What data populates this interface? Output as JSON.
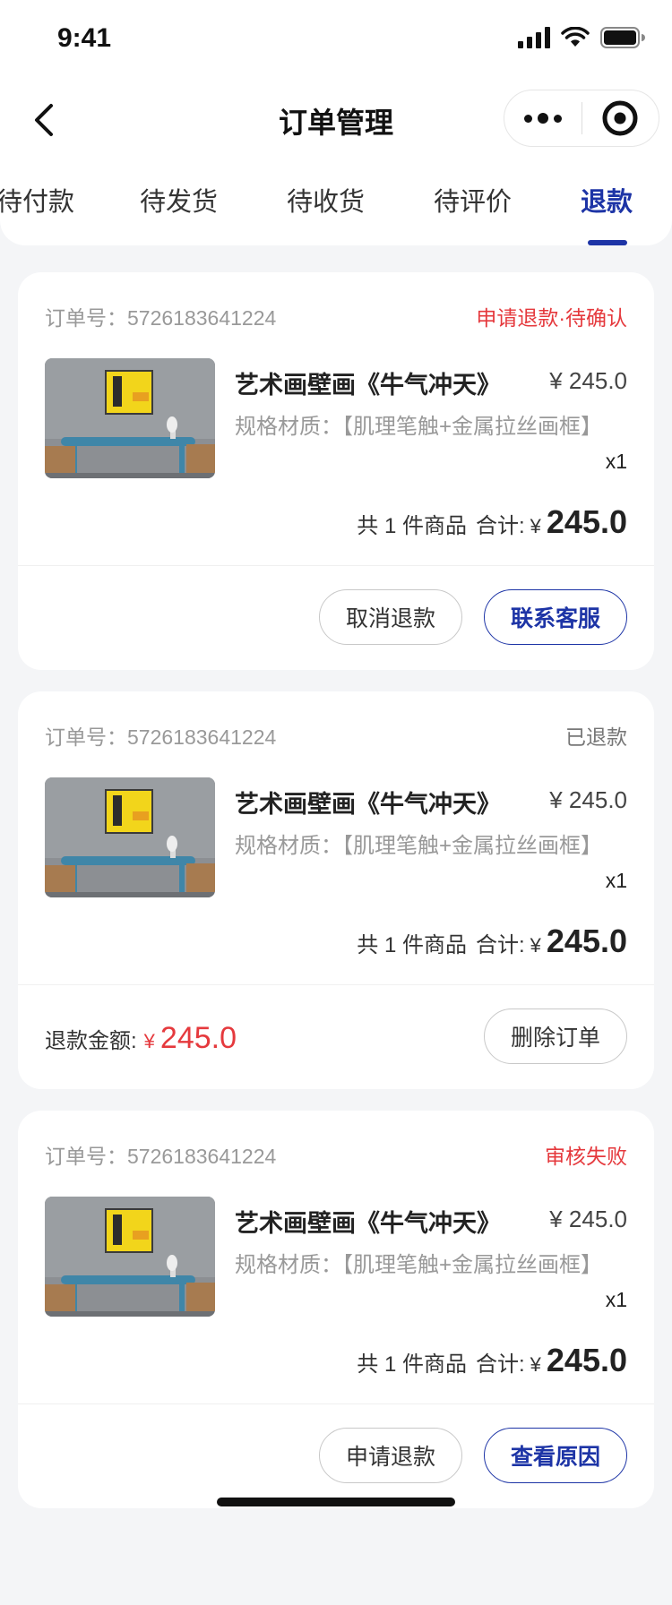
{
  "status_bar": {
    "time": "9:41"
  },
  "nav": {
    "title": "订单管理"
  },
  "tabs": [
    {
      "label": "待付款",
      "active": false
    },
    {
      "label": "待发货",
      "active": false
    },
    {
      "label": "待收货",
      "active": false
    },
    {
      "label": "待评价",
      "active": false
    },
    {
      "label": "退款",
      "active": true
    }
  ],
  "colors": {
    "accent": "#1d34a6",
    "danger": "#e5393d",
    "background": "#f4f5f7"
  },
  "orders": [
    {
      "order_no": "订单号：5726183641224",
      "status": "申请退款·待确认",
      "product_name": "艺术画壁画《牛气冲天》",
      "price": "¥ 245.0",
      "spec": "规格材质：【肌理笔触+金属拉丝画框】",
      "qty": "x1",
      "summary_count": "共 1 件商品",
      "summary_label": "合计:",
      "currency": "¥",
      "total": "245.0",
      "buttons": [
        "取消退款",
        "联系客服"
      ]
    },
    {
      "order_no": "订单号：5726183641224",
      "status": "已退款",
      "product_name": "艺术画壁画《牛气冲天》",
      "price": "¥ 245.0",
      "spec": "规格材质：【肌理笔触+金属拉丝画框】",
      "qty": "x1",
      "summary_count": "共 1 件商品",
      "summary_label": "合计:",
      "currency": "¥",
      "total": "245.0",
      "refund_label": "退款金额:",
      "refund_currency": "¥",
      "refund_amount": "245.0",
      "buttons": [
        "删除订单"
      ]
    },
    {
      "order_no": "订单号：5726183641224",
      "status": "审核失败",
      "product_name": "艺术画壁画《牛气冲天》",
      "price": "¥ 245.0",
      "spec": "规格材质：【肌理笔触+金属拉丝画框】",
      "qty": "x1",
      "summary_count": "共 1 件商品",
      "summary_label": "合计:",
      "currency": "¥",
      "total": "245.0",
      "buttons": [
        "申请退款",
        "查看原因"
      ]
    }
  ]
}
